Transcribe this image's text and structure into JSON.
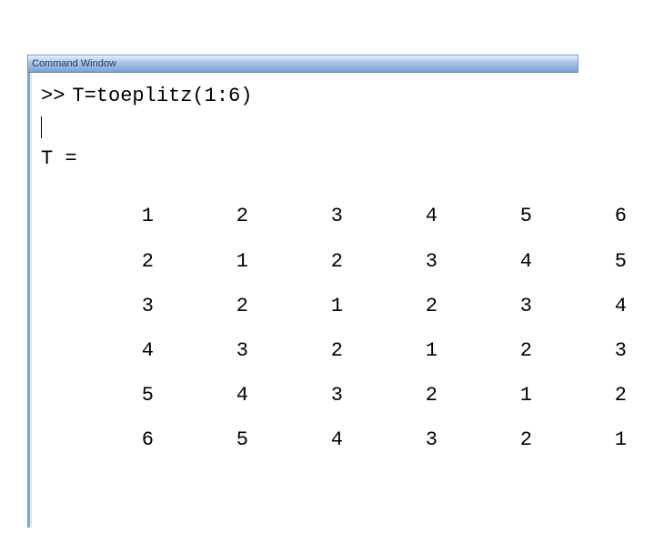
{
  "window": {
    "title": "Command Window"
  },
  "console": {
    "prompt": ">>",
    "command": "T=toeplitz(1:6)",
    "result_label": "T =",
    "matrix": [
      [
        "1",
        "2",
        "3",
        "4",
        "5",
        "6"
      ],
      [
        "2",
        "1",
        "2",
        "3",
        "4",
        "5"
      ],
      [
        "3",
        "2",
        "1",
        "2",
        "3",
        "4"
      ],
      [
        "4",
        "3",
        "2",
        "1",
        "2",
        "3"
      ],
      [
        "5",
        "4",
        "3",
        "2",
        "1",
        "2"
      ],
      [
        "6",
        "5",
        "4",
        "3",
        "2",
        "1"
      ]
    ]
  }
}
